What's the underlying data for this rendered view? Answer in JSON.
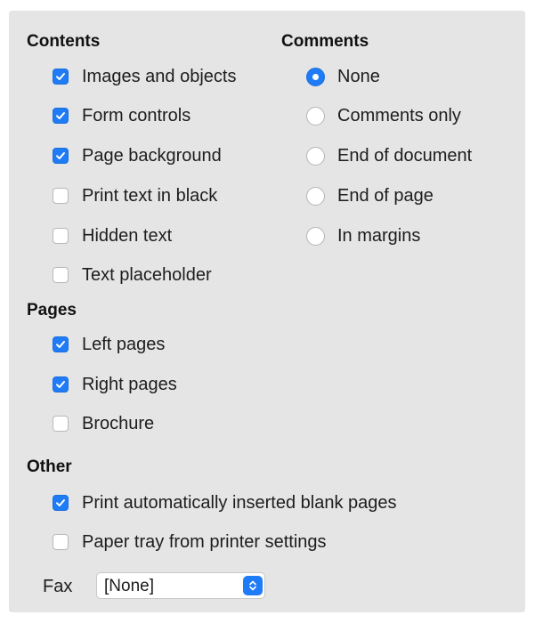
{
  "contents": {
    "title": "Contents",
    "items": [
      {
        "label": "Images and objects",
        "checked": true
      },
      {
        "label": "Form controls",
        "checked": true
      },
      {
        "label": "Page background",
        "checked": true
      },
      {
        "label": "Print text in black",
        "checked": false
      },
      {
        "label": "Hidden text",
        "checked": false
      },
      {
        "label": "Text placeholder",
        "checked": false
      }
    ]
  },
  "comments": {
    "title": "Comments",
    "options": [
      {
        "label": "None",
        "selected": true
      },
      {
        "label": "Comments only",
        "selected": false
      },
      {
        "label": "End of document",
        "selected": false
      },
      {
        "label": "End of page",
        "selected": false
      },
      {
        "label": "In margins",
        "selected": false
      }
    ]
  },
  "pages": {
    "title": "Pages",
    "items": [
      {
        "label": "Left pages",
        "checked": true
      },
      {
        "label": "Right pages",
        "checked": true
      },
      {
        "label": "Brochure",
        "checked": false
      }
    ]
  },
  "other": {
    "title": "Other",
    "items": [
      {
        "label": "Print automatically inserted blank pages",
        "checked": true
      },
      {
        "label": "Paper tray from printer settings",
        "checked": false
      }
    ]
  },
  "fax": {
    "label": "Fax",
    "value": "[None]"
  },
  "colors": {
    "accent": "#1f7cf6",
    "panel_background": "#e5e5e5"
  }
}
